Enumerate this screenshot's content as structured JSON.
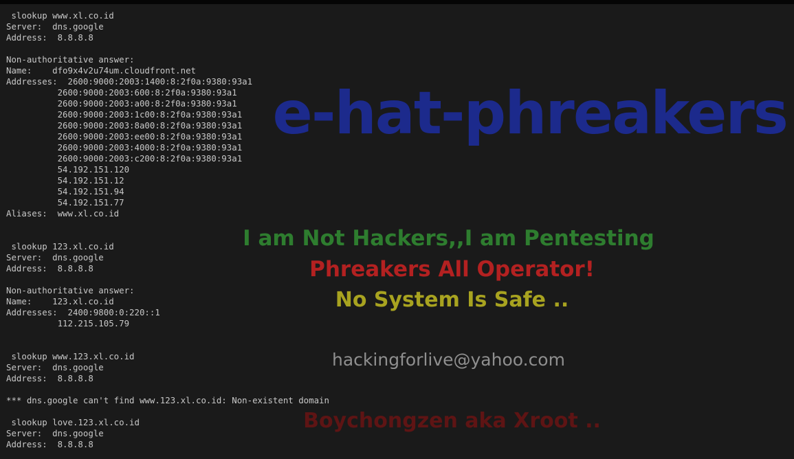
{
  "wallpaper": {
    "title": "e-hat-phreakers",
    "motto": "I am Not Hackers,,I am Pentesting",
    "slogan": "Phreakers All Operator!",
    "safe": "No System Is Safe ..",
    "email": "hackingforlive@yahoo.com",
    "signature": "Boychongzen aka Xroot ..",
    "colors": {
      "background": "#1a1a1a",
      "title": "#1c2a8c",
      "motto": "#2e7d2f",
      "slogan": "#b32121",
      "safe": "#a8a320",
      "email": "#8f8f8f",
      "signature": "#5e1414",
      "console_text": "#c8c8c8"
    }
  },
  "console": {
    "lines": [
      " slookup www.xl.co.id",
      "Server:  dns.google",
      "Address:  8.8.8.8",
      "",
      "Non-authoritative answer:",
      "Name:    dfo9x4v2u74um.cloudfront.net",
      "Addresses:  2600:9000:2003:1400:8:2f0a:9380:93a1",
      "          2600:9000:2003:600:8:2f0a:9380:93a1",
      "          2600:9000:2003:a00:8:2f0a:9380:93a1",
      "          2600:9000:2003:1c00:8:2f0a:9380:93a1",
      "          2600:9000:2003:8a00:8:2f0a:9380:93a1",
      "          2600:9000:2003:ee00:8:2f0a:9380:93a1",
      "          2600:9000:2003:4000:8:2f0a:9380:93a1",
      "          2600:9000:2003:c200:8:2f0a:9380:93a1",
      "          54.192.151.120",
      "          54.192.151.12",
      "          54.192.151.94",
      "          54.192.151.77",
      "Aliases:  www.xl.co.id",
      "",
      "",
      " slookup 123.xl.co.id",
      "Server:  dns.google",
      "Address:  8.8.8.8",
      "",
      "Non-authoritative answer:",
      "Name:    123.xl.co.id",
      "Addresses:  2400:9800:0:220::1",
      "          112.215.105.79",
      "",
      "",
      " slookup www.123.xl.co.id",
      "Server:  dns.google",
      "Address:  8.8.8.8",
      "",
      "*** dns.google can't find www.123.xl.co.id: Non-existent domain",
      "",
      " slookup love.123.xl.co.id",
      "Server:  dns.google",
      "Address:  8.8.8.8"
    ]
  }
}
